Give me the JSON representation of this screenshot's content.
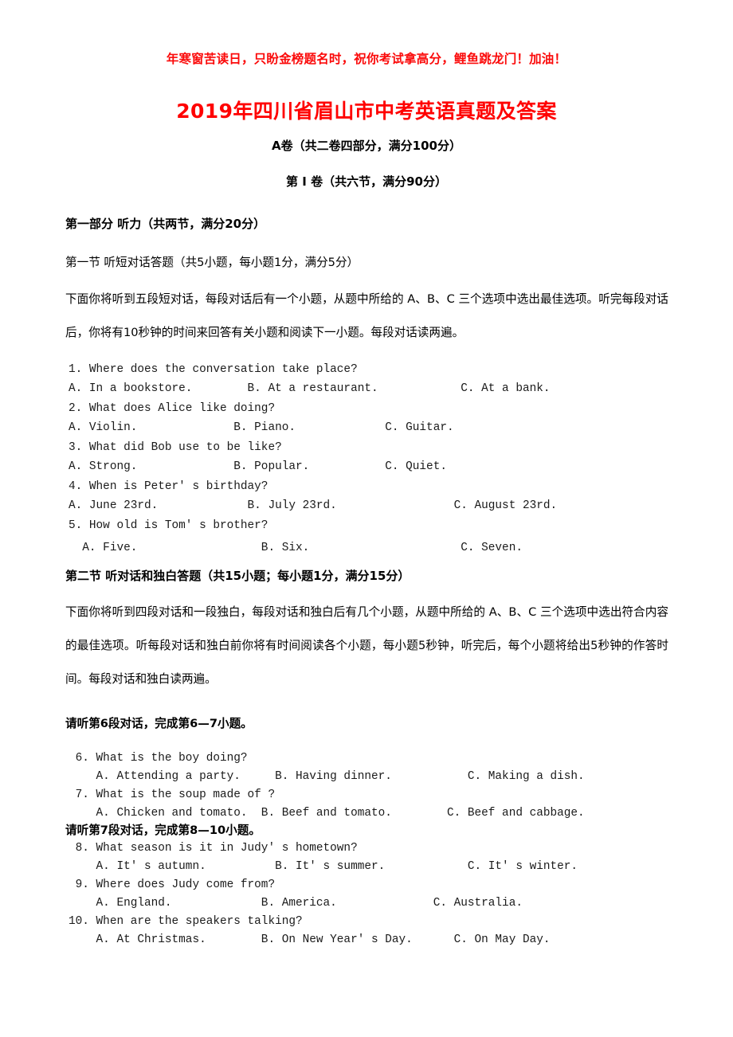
{
  "banner": {
    "text": "年寒窗苦读日，只盼金榜题名时，祝你考试拿高分，鲤鱼跳龙门！加油！",
    "color": "#fb0a0a"
  },
  "title": {
    "text": "2019年四川省眉山市中考英语真题及答案",
    "color": "#ff0000"
  },
  "subtitles": {
    "paper_a": "A卷（共二卷四部分，满分100分）",
    "volume_1": "第 Ⅰ 卷（共六节，满分90分）"
  },
  "part_one": {
    "heading": "第一部分   听力（共两节，满分20分）",
    "section_one": {
      "heading": "第一节   听短对话答题（共5小题，每小题1分，满分5分）",
      "instruction": "下面你将听到五段短对话，每段对话后有一个小题，从题中所给的 A、B、C 三个选项中选出最佳选项。听完每段对话后，你将有10秒钟的时间来回答有关小题和阅读下一小题。每段对话读两遍。",
      "questions": [
        {
          "stem": "1. Where does the conversation take place?",
          "options_line": "A. In a bookstore.        B. At a restaurant.            C. At a bank."
        },
        {
          "stem": "2. What does Alice like doing?",
          "options_line": "A. Violin.              B. Piano.             C. Guitar."
        },
        {
          "stem": "3. What did Bob use to be like?",
          "options_line": "A. Strong.              B. Popular.           C. Quiet."
        },
        {
          "stem": "4. When is Peter' s birthday?",
          "options_line": "A. June 23rd.             B. July 23rd.                 C. August 23rd."
        },
        {
          "stem": "5. How old is Tom' s brother?",
          "options_line": "  A. Five.                  B. Six.                      C. Seven."
        }
      ]
    },
    "section_two": {
      "heading": "第二节   听对话和独白答题（共15小题；每小题1分，满分15分）",
      "instruction": "下面你将听到四段对话和一段独白，每段对话和独白后有几个小题，从题中所给的 A、B、C 三个选项中选出符合内容的最佳选项。听每段对话和独白前你将有时间阅读各个小题，每小题5秒钟，听完后，每个小题将给出5秒钟的作答时间。每段对话和独白读两遍。",
      "cue_dialog_6": "请听第6段对话，完成第6—7小题。",
      "questions_6_7": [
        {
          "stem": " 6. What is the boy doing?",
          "options_line": "    A. Attending a party.     B. Having dinner.           C. Making a dish."
        },
        {
          "stem": " 7. What is the soup made of ?",
          "options_line": "    A. Chicken and tomato.  B. Beef and tomato.        C. Beef and cabbage."
        }
      ],
      "cue_dialog_7": "请听第7段对话，完成第8—10小题。",
      "questions_8_10": [
        {
          "stem": " 8. What season is it in Judy' s hometown?",
          "options_line": "    A. It' s autumn.          B. It' s summer.            C. It' s winter."
        },
        {
          "stem": " 9. Where does Judy come from?",
          "options_line": "    A. England.             B. America.              C. Australia."
        },
        {
          "stem": "10. When are the speakers talking?",
          "options_line": "    A. At Christmas.        B. On New Year' s Day.      C. On May Day."
        }
      ]
    }
  }
}
